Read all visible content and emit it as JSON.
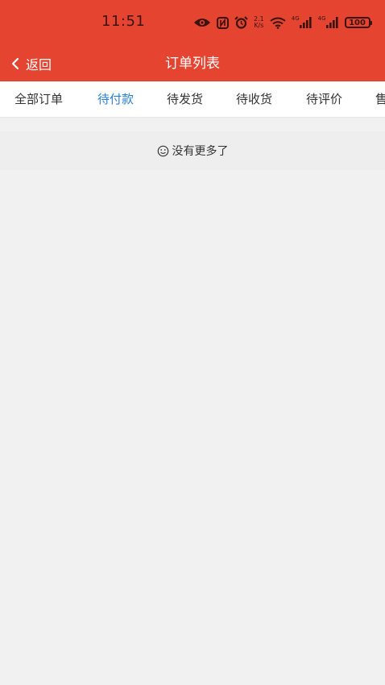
{
  "status_bar": {
    "time": "11:51",
    "net_speed_value": "2.1",
    "net_speed_unit": "K/s",
    "signal_1": "4G",
    "signal_2": "4G",
    "battery": "100",
    "icons": [
      "eye-icon",
      "nfc-icon",
      "alarm-icon",
      "net-speed",
      "wifi-icon",
      "signal-4g-icon",
      "signal-4g-icon",
      "battery-icon"
    ]
  },
  "header": {
    "back_label": "返回",
    "title": "订单列表",
    "background_color": "#e54430"
  },
  "tabs": [
    {
      "label": "全部订单",
      "active": false
    },
    {
      "label": "待付款",
      "active": true
    },
    {
      "label": "待发货",
      "active": false
    },
    {
      "label": "待收货",
      "active": false
    },
    {
      "label": "待评价",
      "active": false
    },
    {
      "label": "售",
      "active": false
    }
  ],
  "tab_active_color": "#2b7fd0",
  "list": {
    "empty_text": "没有更多了",
    "empty_icon": "smile-icon"
  }
}
